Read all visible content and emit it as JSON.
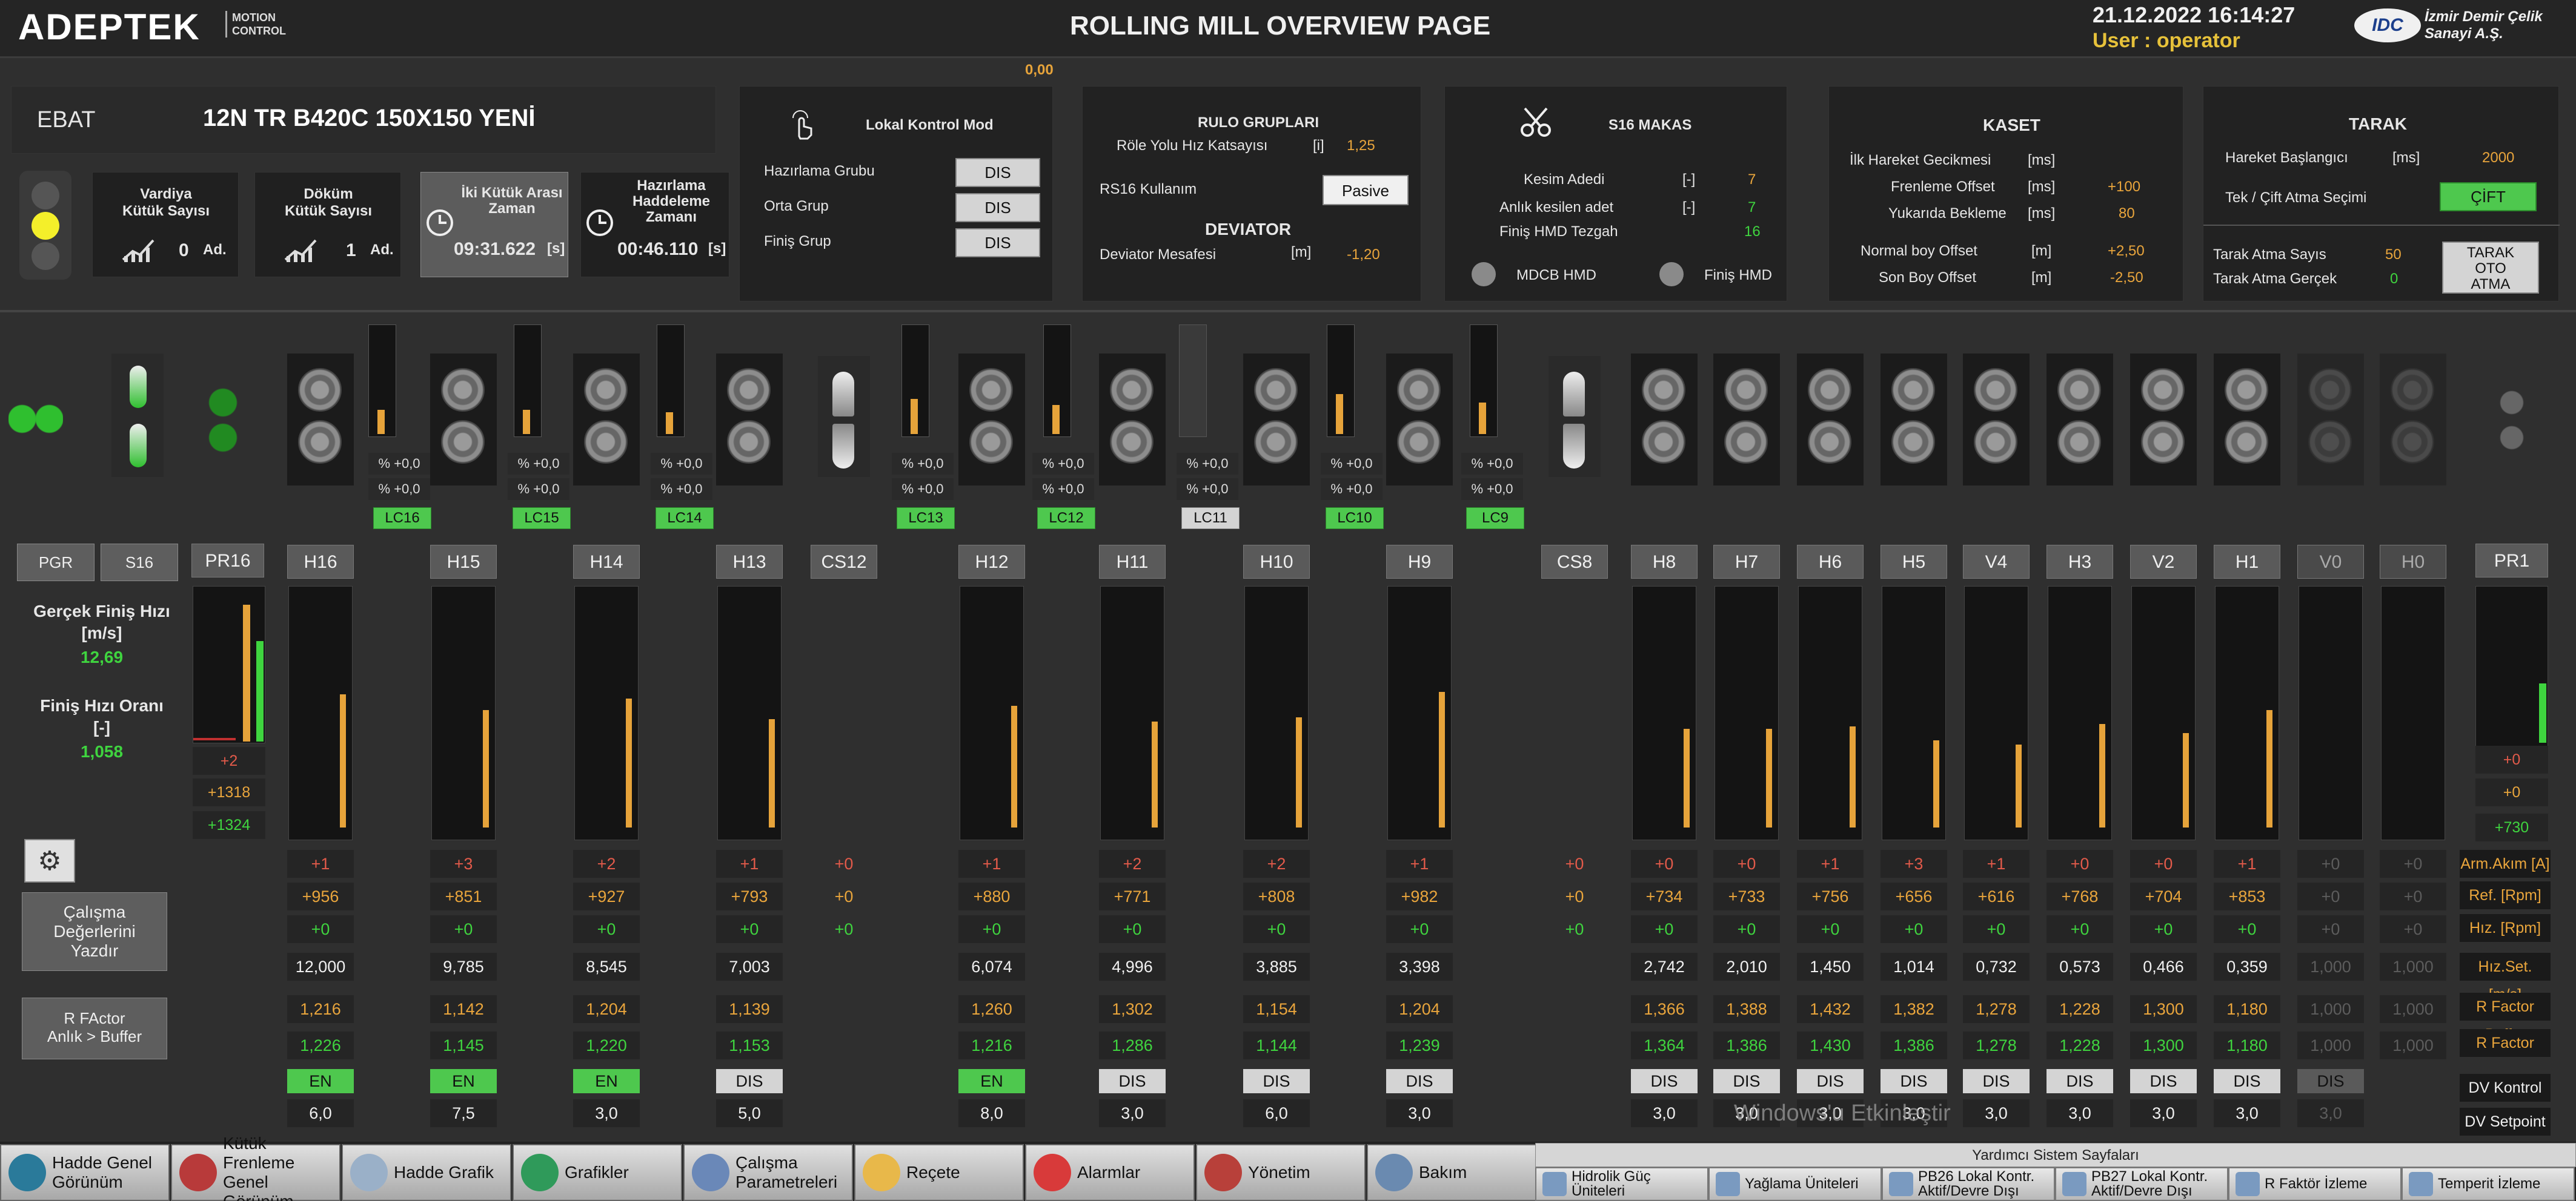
{
  "header": {
    "brand": "ADEPTEK",
    "brand_sub1": "MOTION",
    "brand_sub2": "CONTROL",
    "title": "ROLLING MILL OVERVIEW PAGE",
    "datetime": "21.12.2022 16:14:27",
    "user_label": "User :",
    "user": "operator",
    "idc": "IDC",
    "company1": "İzmir Demir Çelik",
    "company2": "Sanayi A.Ş.",
    "top_value": "0,00"
  },
  "ebat": {
    "label": "EBAT",
    "value": "12N TR B420C 150X150 YENİ"
  },
  "counters": {
    "vardiya_title1": "Vardiya",
    "vardiya_title2": "Kütük Sayısı",
    "vardiya_value": "0",
    "vardiya_unit": "Ad.",
    "dokum_title1": "Döküm",
    "dokum_title2": "Kütük Sayısı",
    "dokum_value": "1",
    "dokum_unit": "Ad.",
    "kutuk_arasi_title1": "İki Kütük Arası",
    "kutuk_arasi_title2": "Zaman",
    "kutuk_arasi_value": "09:31.622",
    "kutuk_arasi_unit": "[s]",
    "haddeleme_title1": "Hazırlama",
    "haddeleme_title2": "Haddeleme",
    "haddeleme_title3": "Zamanı",
    "haddeleme_value": "00:46.110",
    "haddeleme_unit": "[s]"
  },
  "lokal": {
    "title": "Lokal Kontrol Mod",
    "rows": [
      {
        "label": "Hazırlama Grubu",
        "state": "DIS"
      },
      {
        "label": "Orta Grup",
        "state": "DIS"
      },
      {
        "label": "Finiş Grup",
        "state": "DIS"
      }
    ]
  },
  "rulo": {
    "title": "RULO GRUPLARI",
    "hiz_label": "Röle Yolu Hız Katsayısı",
    "hiz_unit": "[i]",
    "hiz_value": "1,25",
    "rs16_label": "RS16 Kullanım",
    "rs16_state": "Pasive",
    "deviator_title": "DEVIATOR",
    "dev_label": "Deviator Mesafesi",
    "dev_unit": "[m]",
    "dev_value": "-1,20"
  },
  "makas": {
    "title": "S16 MAKAS",
    "rows": [
      {
        "label": "Kesim Adedi",
        "unit": "[-]",
        "value": "7"
      },
      {
        "label": "Anlık kesilen adet",
        "unit": "[-]",
        "value": "7"
      },
      {
        "label": "Finiş HMD Tezgah",
        "unit": "",
        "value": "16"
      }
    ],
    "mdcb": "MDCB HMD",
    "finis": "Finiş HMD"
  },
  "kaset": {
    "title": "KASET",
    "rows": [
      {
        "label": "İlk Hareket Gecikmesi",
        "unit": "[ms]",
        "value": ""
      },
      {
        "label": "Frenleme Offset",
        "unit": "[ms]",
        "value": "+100"
      },
      {
        "label": "Yukarıda Bekleme",
        "unit": "[ms]",
        "value": "80"
      },
      {
        "label": "Normal boy Offset",
        "unit": "[m]",
        "value": "+2,50"
      },
      {
        "label": "Son Boy Offset",
        "unit": "[m]",
        "value": "-2,50"
      }
    ]
  },
  "tarak": {
    "title": "TARAK",
    "baslangic_label": "Hareket Başlangıcı",
    "baslangic_unit": "[ms]",
    "baslangic_value": "2000",
    "secim_label": "Tek / Çift Atma Seçimi",
    "secim_value": "ÇİFT",
    "sayisi_label": "Tarak Atma Sayıs",
    "sayisi_value": "50",
    "gercek_label": "Tarak Atma Gerçek",
    "gercek_value": "0",
    "oto1": "TARAK",
    "oto2": "OTO",
    "oto3": "ATMA"
  },
  "left": {
    "pgr": "PGR",
    "s16": "S16",
    "gercek_label1": "Gerçek Finiş Hızı",
    "gercek_label2": "[m/s]",
    "gercek_value": "12,69",
    "oran_label1": "Finiş Hızı Oranı",
    "oran_label2": "[-]",
    "oran_value": "1,058",
    "calisma1": "Çalışma",
    "calisma2": "Değerlerini",
    "calisma3": "Yazdır",
    "rfactor1": "R FActor",
    "rfactor2": "Anlık > Buffer",
    "pr16": "PR16",
    "pr16_vals": [
      "+2",
      "+1318",
      "+1324"
    ],
    "pr1": "PR1",
    "pr1_vals": [
      "+0",
      "+0",
      "+730"
    ]
  },
  "lc_labels": [
    "LC16",
    "LC15",
    "LC14",
    "LC13",
    "LC12",
    "LC11",
    "LC10",
    "LC9"
  ],
  "pct_value": "% +0,0",
  "row_labels": [
    "Arm.Akım [A]",
    "Ref. [Rpm]",
    "Hız. [Rpm]",
    "Hız.Set. [m/s]",
    "R Factor Buffer",
    "R Factor",
    "DV Kontrol",
    "DV Setpoint"
  ],
  "stands": [
    {
      "name": "H16",
      "arm": "+1",
      "ref": "+956",
      "hiz": "+0",
      "set": "12,000",
      "rfb": "1,216",
      "rf": "1,226",
      "dv": "EN",
      "dvs": "6,0",
      "level": 0.58
    },
    {
      "name": "H15",
      "arm": "+3",
      "ref": "+851",
      "hiz": "+0",
      "set": "9,785",
      "rfb": "1,142",
      "rf": "1,145",
      "dv": "EN",
      "dvs": "7,5",
      "level": 0.51
    },
    {
      "name": "H14",
      "arm": "+2",
      "ref": "+927",
      "hiz": "+0",
      "set": "8,545",
      "rfb": "1,204",
      "rf": "1,220",
      "dv": "EN",
      "dvs": "3,0",
      "level": 0.56
    },
    {
      "name": "H13",
      "arm": "+1",
      "ref": "+793",
      "hiz": "+0",
      "set": "7,003",
      "rfb": "1,139",
      "rf": "1,153",
      "dv": "DIS",
      "dvs": "5,0",
      "level": 0.47
    },
    {
      "name": "CS12",
      "arm": "+0",
      "ref": "+0",
      "hiz": "+0",
      "set": "",
      "rfb": "",
      "rf": "",
      "dv": "",
      "dvs": "",
      "level": 0
    },
    {
      "name": "H12",
      "arm": "+1",
      "ref": "+880",
      "hiz": "+0",
      "set": "6,074",
      "rfb": "1,260",
      "rf": "1,216",
      "dv": "EN",
      "dvs": "8,0",
      "level": 0.53
    },
    {
      "name": "H11",
      "arm": "+2",
      "ref": "+771",
      "hiz": "+0",
      "set": "4,996",
      "rfb": "1,302",
      "rf": "1,286",
      "dv": "DIS",
      "dvs": "3,0",
      "level": 0.46
    },
    {
      "name": "H10",
      "arm": "+2",
      "ref": "+808",
      "hiz": "+0",
      "set": "3,885",
      "rfb": "1,154",
      "rf": "1,144",
      "dv": "DIS",
      "dvs": "6,0",
      "level": 0.48
    },
    {
      "name": "H9",
      "arm": "+1",
      "ref": "+982",
      "hiz": "+0",
      "set": "3,398",
      "rfb": "1,204",
      "rf": "1,239",
      "dv": "DIS",
      "dvs": "3,0",
      "level": 0.59
    },
    {
      "name": "CS8",
      "arm": "+0",
      "ref": "+0",
      "hiz": "+0",
      "set": "",
      "rfb": "",
      "rf": "",
      "dv": "",
      "dvs": "",
      "level": 0
    },
    {
      "name": "H8",
      "arm": "+0",
      "ref": "+734",
      "hiz": "+0",
      "set": "2,742",
      "rfb": "1,366",
      "rf": "1,364",
      "dv": "DIS",
      "dvs": "3,0",
      "level": 0.43
    },
    {
      "name": "H7",
      "arm": "+0",
      "ref": "+733",
      "hiz": "+0",
      "set": "2,010",
      "rfb": "1,388",
      "rf": "1,386",
      "dv": "DIS",
      "dvs": "3,0",
      "level": 0.43
    },
    {
      "name": "H6",
      "arm": "+1",
      "ref": "+756",
      "hiz": "+0",
      "set": "1,450",
      "rfb": "1,432",
      "rf": "1,430",
      "dv": "DIS",
      "dvs": "3,0",
      "level": 0.44
    },
    {
      "name": "H5",
      "arm": "+3",
      "ref": "+656",
      "hiz": "+0",
      "set": "1,014",
      "rfb": "1,382",
      "rf": "1,386",
      "dv": "DIS",
      "dvs": "3,0",
      "level": 0.38
    },
    {
      "name": "V4",
      "arm": "+1",
      "ref": "+616",
      "hiz": "+0",
      "set": "0,732",
      "rfb": "1,278",
      "rf": "1,278",
      "dv": "DIS",
      "dvs": "3,0",
      "level": 0.36
    },
    {
      "name": "H3",
      "arm": "+0",
      "ref": "+768",
      "hiz": "+0",
      "set": "0,573",
      "rfb": "1,228",
      "rf": "1,228",
      "dv": "DIS",
      "dvs": "3,0",
      "level": 0.45
    },
    {
      "name": "V2",
      "arm": "+0",
      "ref": "+704",
      "hiz": "+0",
      "set": "0,466",
      "rfb": "1,300",
      "rf": "1,300",
      "dv": "DIS",
      "dvs": "3,0",
      "level": 0.41
    },
    {
      "name": "H1",
      "arm": "+1",
      "ref": "+853",
      "hiz": "+0",
      "set": "0,359",
      "rfb": "1,180",
      "rf": "1,180",
      "dv": "DIS",
      "dvs": "3,0",
      "level": 0.51
    },
    {
      "name": "V0",
      "arm": "+0",
      "ref": "+0",
      "hiz": "+0",
      "set": "1,000",
      "rfb": "1,000",
      "rf": "1,000",
      "dv": "DIS",
      "dvs": "3,0",
      "level": 0
    },
    {
      "name": "H0",
      "arm": "+0",
      "ref": "+0",
      "hiz": "+0",
      "set": "1,000",
      "rfb": "1,000",
      "rf": "1,000",
      "dv": "",
      "dvs": "",
      "level": 0
    }
  ],
  "nav": {
    "items": [
      "Hadde Genel Görünüm",
      "Kütük Frenleme Genel Görünüm",
      "Hadde Grafik",
      "Grafikler",
      "Çalışma Parametreleri",
      "Reçete",
      "Alarmlar",
      "Yönetim",
      "Bakım"
    ],
    "sys_title": "Yardımcı Sistem Sayfaları",
    "sys_items": [
      "Hidrolik Güç Üniteleri",
      "Yağlama Üniteleri",
      "PB26 Lokal Kontr. Aktif/Devre Dışı",
      "PB27 Lokal Kontr. Aktif/Devre Dışı",
      "R Faktör İzleme",
      "Temperit İzleme"
    ],
    "watermark": "Windows'u Etkinleştir"
  },
  "colors": {
    "accent_orange": "#e6a33a",
    "green": "#4ec84e",
    "bg": "#2f2f2f"
  }
}
